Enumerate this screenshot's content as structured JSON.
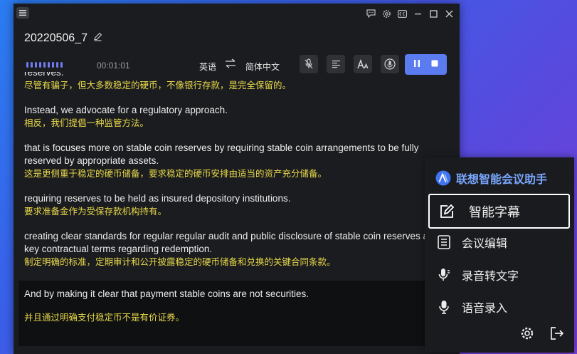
{
  "window": {
    "title": "20220506_7",
    "timer": "00:01:01",
    "source_lang": "英语",
    "target_lang": "简体中文",
    "recording_bars": 9
  },
  "transcript": {
    "partial_top_en": "reserves.",
    "segments": [
      {
        "en": "",
        "zh": "尽管有骗子，但大多数稳定的硬币，不像银行存款，是完全保留的。"
      },
      {
        "en": "Instead, we advocate for a regulatory approach.",
        "zh": "相反，我们提倡一种监管方法。"
      },
      {
        "en": "that is focuses more on stable coin reserves by requiring stable coin arrangements to be fully reserved by appropriate assets.",
        "zh": "这是更侧重于稳定的硬币储备，要求稳定的硬币安排由适当的资产充分储备。"
      },
      {
        "en": "requiring reserves to be held as insured depository institutions.",
        "zh": "要求准备金作为受保存款机构持有。"
      },
      {
        "en": "creating clear standards for regular regular audit and public disclosure of stable coin reserves and key contractual terms regarding redemption.",
        "zh": "制定明确的标准，定期审计和公开披露稳定的硬币储备和兑换的关键合同条款。"
      }
    ],
    "current": {
      "en": "And by making it clear that payment stable coins are not securities.",
      "zh": "并且通过明确支付稳定币不是有价证券。"
    }
  },
  "panel": {
    "brand": "联想智能会议助手",
    "items": [
      {
        "label": "智能字幕",
        "icon": "edit-square-icon",
        "selected": true
      },
      {
        "label": "会议编辑",
        "icon": "document-icon",
        "selected": false
      },
      {
        "label": "录音转文字",
        "icon": "mic-to-text-icon",
        "selected": false
      },
      {
        "label": "语音录入",
        "icon": "microphone-icon",
        "selected": false
      }
    ]
  },
  "colors": {
    "accent": "#5a7cf0",
    "chinese_text": "#e7d84a",
    "brand_text": "#7aa7ff",
    "window_bg": "#1b1c1f"
  }
}
